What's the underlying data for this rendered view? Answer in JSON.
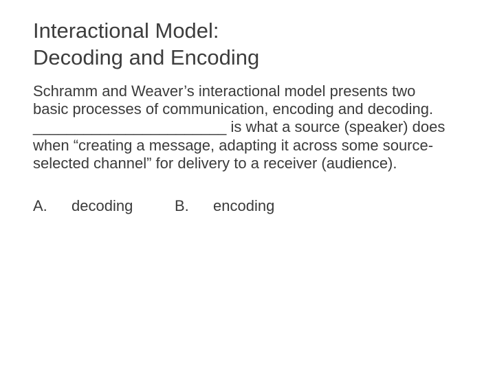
{
  "title_line1": "Interactional Model:",
  "title_line2": "Decoding and Encoding",
  "body_text": "Schramm and Weaver’s interactional model presents two basic processes of communication, encoding and decoding. _______________________ is what a source (speaker) does when “creating a message, adapting it across some source-selected channel” for delivery to a receiver (audience).",
  "options": {
    "a_letter": "A.",
    "a_text": "decoding",
    "b_letter": "B.",
    "b_text": "encoding"
  }
}
